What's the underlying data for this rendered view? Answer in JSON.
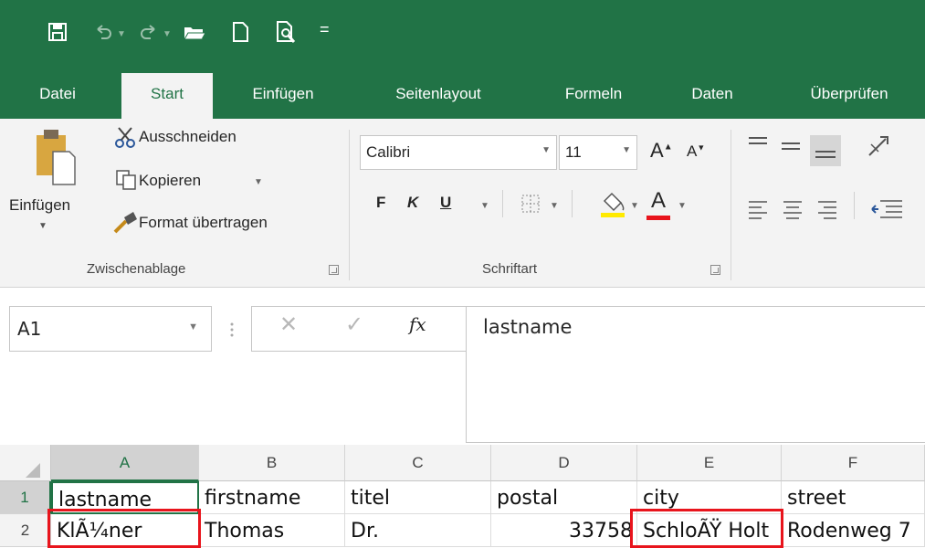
{
  "quick_access": {
    "icons": [
      "save-icon",
      "undo-icon",
      "redo-icon",
      "open-folder-icon",
      "new-document-icon",
      "print-preview-icon",
      "customize-qat-icon"
    ],
    "customize_glyph": "="
  },
  "tabs": [
    {
      "label": "Datei",
      "active": false
    },
    {
      "label": "Start",
      "active": true
    },
    {
      "label": "Einfügen",
      "active": false
    },
    {
      "label": "Seitenlayout",
      "active": false
    },
    {
      "label": "Formeln",
      "active": false
    },
    {
      "label": "Daten",
      "active": false
    },
    {
      "label": "Überprüfen",
      "active": false
    }
  ],
  "ribbon": {
    "clipboard": {
      "paste_label": "Einfügen",
      "cut_label": "Ausschneiden",
      "copy_label": "Kopieren",
      "format_painter_label": "Format übertragen",
      "group_label": "Zwischenablage"
    },
    "font": {
      "font_name": "Calibri",
      "font_size": "11",
      "grow_label": "A",
      "shrink_label": "A",
      "bold_label": "F",
      "italic_label": "K",
      "underline_label": "U",
      "font_color_label": "A",
      "group_label": "Schriftart"
    }
  },
  "formula_bar": {
    "name_box": "A1",
    "fx_label": "fx",
    "cancel_glyph": "✕",
    "enter_glyph": "✓",
    "content": "lastname"
  },
  "sheet": {
    "columns": [
      "A",
      "B",
      "C",
      "D",
      "E",
      "F"
    ],
    "rows": [
      {
        "number": "1",
        "cells": [
          "lastname",
          "firstname",
          "titel",
          "postal",
          "city",
          "street"
        ]
      },
      {
        "number": "2",
        "cells": [
          "KlÃ¼ner",
          "Thomas",
          "Dr.",
          "33758",
          "SchloÃŸ Holt",
          "Rodenweg 7"
        ]
      }
    ]
  },
  "colors": {
    "accent": "#217346",
    "highlight_box": "#e8141c",
    "ribbon_bg": "#f3f3f3"
  }
}
